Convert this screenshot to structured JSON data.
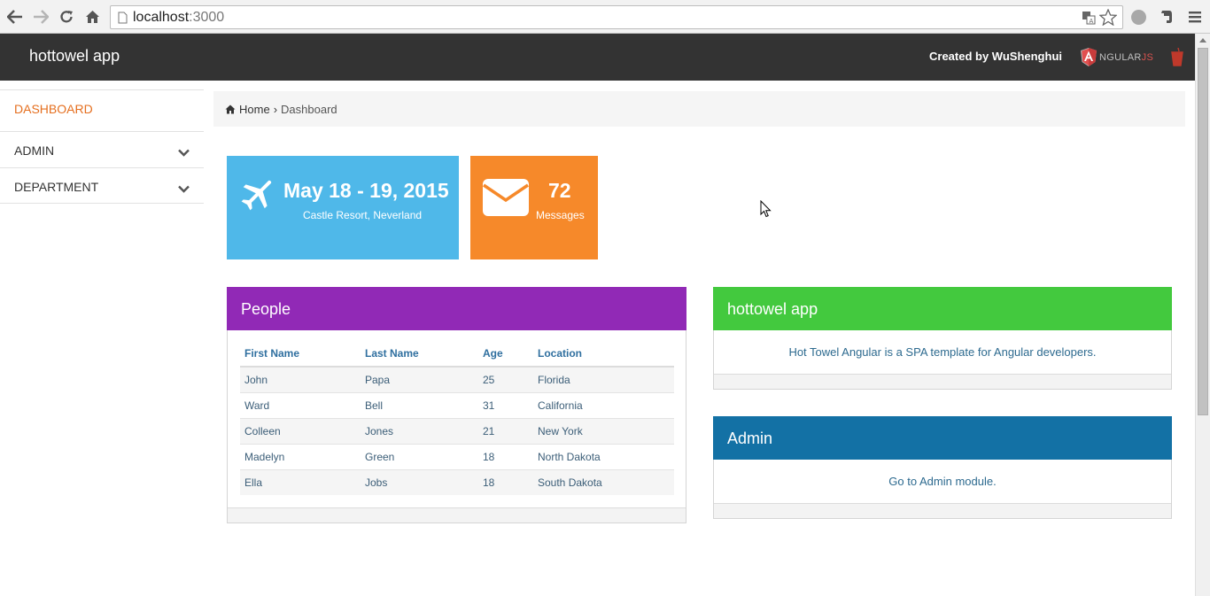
{
  "browser": {
    "url_host": "localhost",
    "url_port": ":3000"
  },
  "navbar": {
    "brand": "hottowel app",
    "created_by": "Created by WuShenghui",
    "angular_text": "NGULAR",
    "angular_js": "JS"
  },
  "sidebar": {
    "items": [
      {
        "label": "DASHBOARD",
        "active": true
      },
      {
        "label": "ADMIN",
        "has_submenu": true
      },
      {
        "label": "DEPARTMENT",
        "has_submenu": true
      }
    ]
  },
  "breadcrumb": {
    "home": "Home",
    "current": "Dashboard"
  },
  "tiles": {
    "event": {
      "title": "May 18 - 19, 2015",
      "subtitle": "Castle Resort, Neverland",
      "icon": "plane-icon",
      "color": "#4fb8e9"
    },
    "messages": {
      "count": "72",
      "label": "Messages",
      "icon": "envelope-icon",
      "color": "#f6892a"
    }
  },
  "people": {
    "title": "People",
    "columns": [
      "First Name",
      "Last Name",
      "Age",
      "Location"
    ],
    "rows": [
      [
        "John",
        "Papa",
        "25",
        "Florida"
      ],
      [
        "Ward",
        "Bell",
        "31",
        "California"
      ],
      [
        "Colleen",
        "Jones",
        "21",
        "New York"
      ],
      [
        "Madelyn",
        "Green",
        "18",
        "North Dakota"
      ],
      [
        "Ella",
        "Jobs",
        "18",
        "South Dakota"
      ]
    ]
  },
  "info_widget": {
    "title": "hottowel app",
    "text": "Hot Towel Angular is a SPA template for Angular developers."
  },
  "admin_widget": {
    "title": "Admin",
    "text": "Go to Admin module."
  },
  "colors": {
    "navbar": "#333333",
    "accent_active": "#e56f1f",
    "people_header": "#9129b6",
    "info_header": "#43c93e",
    "admin_header": "#1371a5"
  }
}
